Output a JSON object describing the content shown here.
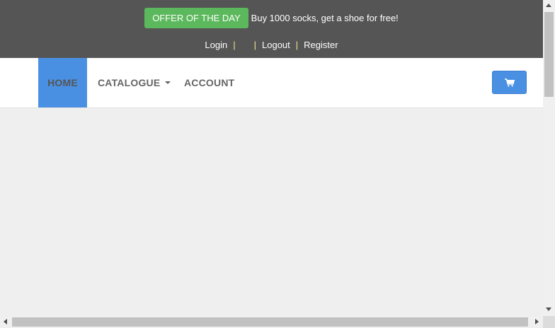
{
  "top_bar": {
    "offer_badge": "OFFER OF THE DAY",
    "offer_text": "Buy 1000 socks, get a shoe for free!",
    "auth": {
      "login": "Login",
      "logout": "Logout",
      "register": "Register",
      "separator": "|"
    }
  },
  "nav": {
    "items": [
      {
        "label": "HOME",
        "active": true
      },
      {
        "label": "CATALOGUE",
        "has_dropdown": true
      },
      {
        "label": "ACCOUNT"
      }
    ],
    "cart_icon": "shopping-cart-icon"
  },
  "colors": {
    "topbar_bg": "#555555",
    "offer_badge": "#5cb85c",
    "accent": "#4a90e2",
    "page_bg": "#efefef"
  }
}
